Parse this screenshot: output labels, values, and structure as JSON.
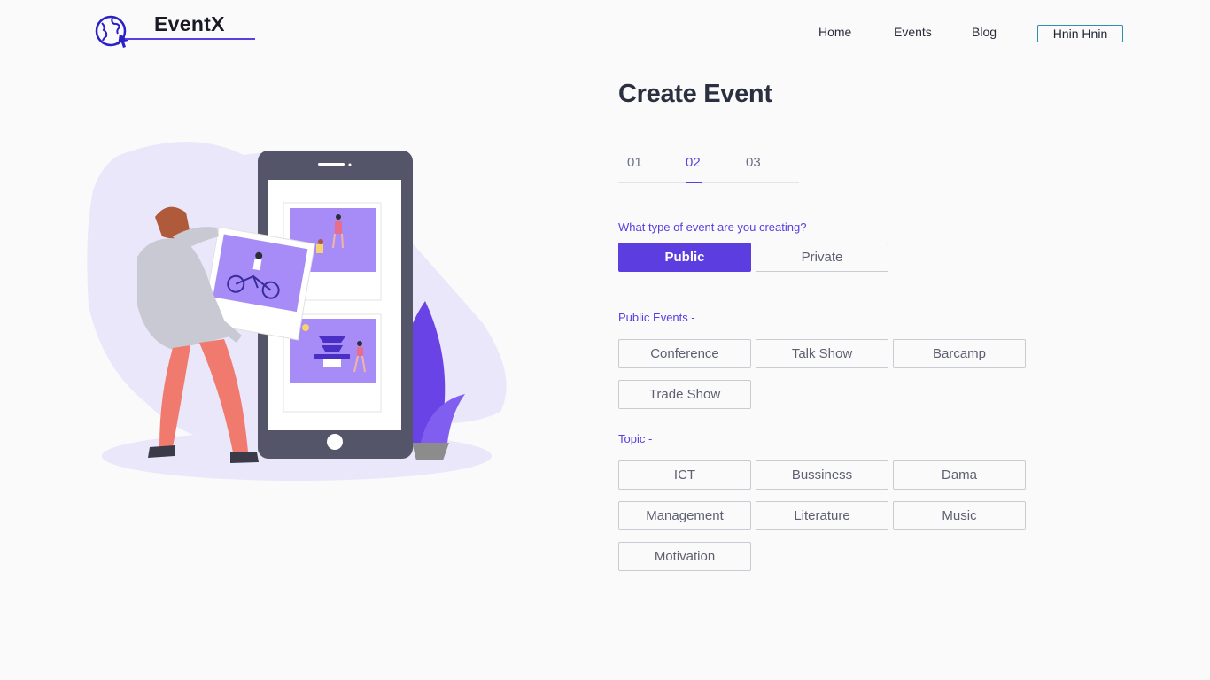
{
  "header": {
    "logo_text": "EventX",
    "nav": [
      {
        "label": "Home"
      },
      {
        "label": "Events"
      },
      {
        "label": "Blog"
      }
    ],
    "user_label": "Hnin Hnin"
  },
  "form": {
    "title": "Create Event",
    "steps": [
      "01",
      "02",
      "03"
    ],
    "active_step": "02",
    "type_question": "What type of event are you creating?",
    "type_options": [
      "Public",
      "Private"
    ],
    "selected_type": "Public",
    "public_events_label": "Public Events -",
    "public_events": [
      "Conference",
      "Talk Show",
      "Barcamp",
      "Trade Show"
    ],
    "topic_label": "Topic -",
    "topics": [
      "ICT",
      "Bussiness",
      "Dama",
      "Management",
      "Literature",
      "Music",
      "Motivation"
    ]
  },
  "colors": {
    "accent": "#5b3de0",
    "border": "#c9cbd3",
    "background": "#fafafa",
    "user_button_border": "#2e8fb3"
  }
}
